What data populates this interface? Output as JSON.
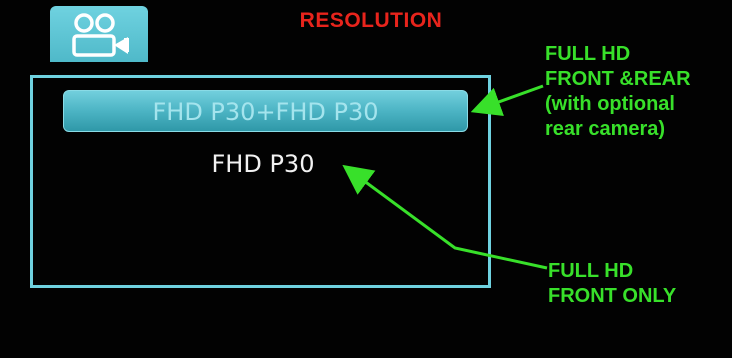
{
  "header": {
    "mode_icon": "video-camera-icon",
    "title": "RESOLUTION"
  },
  "menu": {
    "items": [
      {
        "label": "FHD P30+FHD P30",
        "selected": true
      },
      {
        "label": "FHD P30",
        "selected": false
      }
    ]
  },
  "annotations": {
    "front_rear": {
      "lines": [
        "FULL HD",
        "FRONT &REAR",
        "(with optional",
        "rear camera)"
      ]
    },
    "front_only": {
      "lines": [
        "FULL HD",
        "FRONT ONLY"
      ]
    }
  },
  "colors": {
    "title": "#e8241c",
    "accent": "#6fd2e0",
    "annotation": "#38e02a",
    "background": "#020202"
  }
}
